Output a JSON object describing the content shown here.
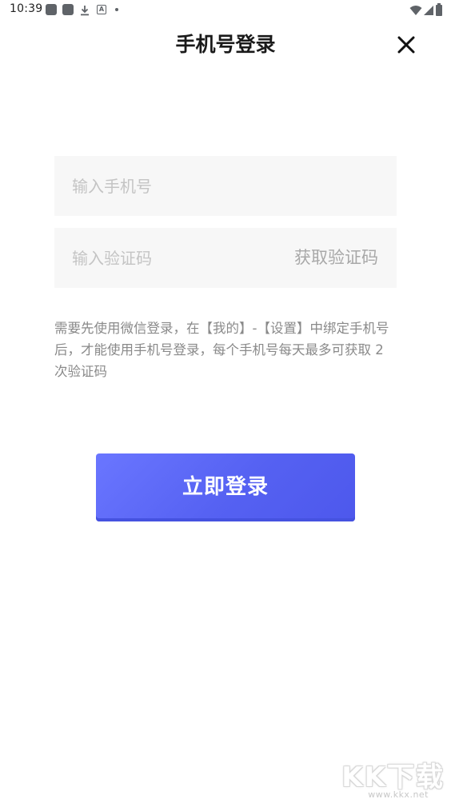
{
  "status_bar": {
    "time": "10:39",
    "icons": [
      "app-icon",
      "app-icon",
      "download-icon",
      "a-icon",
      "dot-icon",
      "wifi-icon",
      "signal-icon",
      "battery-icon"
    ]
  },
  "header": {
    "title": "手机号登录",
    "close_icon": "close-icon"
  },
  "form": {
    "phone_placeholder": "输入手机号",
    "phone_value": "",
    "code_placeholder": "输入验证码",
    "code_value": "",
    "get_code_label": "获取验证码"
  },
  "notice": "需要先使用微信登录，在【我的】-【设置】中绑定手机号后，才能使用手机号登录，每个手机号每天最多可获取 2 次验证码",
  "login_button_label": "立即登录",
  "watermark": {
    "logo": "KK下载",
    "url": "www.kkx.net"
  },
  "colors": {
    "accent": "#5561f2",
    "input_bg": "#f7f7f7",
    "placeholder": "#c4c4c4",
    "muted_text": "#8a8a8a"
  }
}
